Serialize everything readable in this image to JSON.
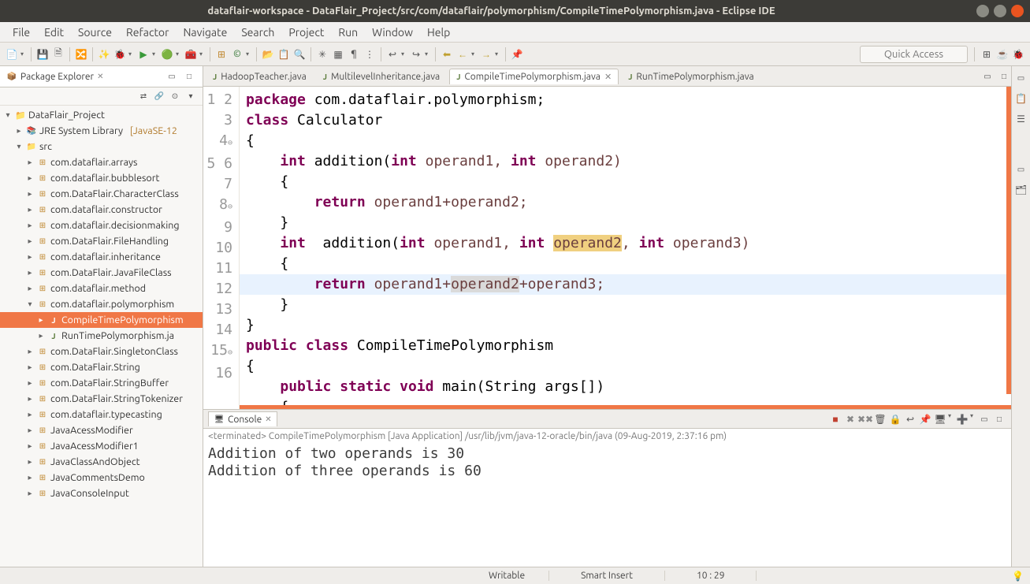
{
  "window": {
    "title": "dataflair-workspace - DataFlair_Project/src/com/dataflair/polymorphism/CompileTimePolymorphism.java - Eclipse IDE"
  },
  "menubar": [
    "File",
    "Edit",
    "Source",
    "Refactor",
    "Navigate",
    "Search",
    "Project",
    "Run",
    "Window",
    "Help"
  ],
  "quick_access": "Quick Access",
  "package_explorer": {
    "title": "Package Explorer",
    "project": "DataFlair_Project",
    "jre": "JRE System Library",
    "jre_ver": "[JavaSE-12",
    "src": "src",
    "packages": [
      "com.dataflair.arrays",
      "com.dataflair.bubblesort",
      "com.DataFlair.CharacterClass",
      "com.dataflair.constructor",
      "com.dataflair.decisionmaking",
      "com.DataFlair.FileHandling",
      "com.dataflair.inheritance",
      "com.DataFlair.JavaFileClass",
      "com.dataflair.method"
    ],
    "open_package": "com.dataflair.polymorphism",
    "open_files": [
      "CompileTimePolymorphism",
      "RunTimePolymorphism.ja"
    ],
    "packages_after": [
      "com.DataFlair.SingletonClass",
      "com.DataFlair.String",
      "com.DataFlair.StringBuffer",
      "com.DataFlair.StringTokenizer",
      "com.dataflair.typecasting",
      "JavaAcessModifier",
      "JavaAcessModifier1",
      "JavaClassAndObject",
      "JavaCommentsDemo",
      "JavaConsoleInput"
    ]
  },
  "editor_tabs": [
    {
      "label": "HadoopTeacher.java",
      "active": false
    },
    {
      "label": "MultilevelInheritance.java",
      "active": false
    },
    {
      "label": "CompileTimePolymorphism.java",
      "active": true
    },
    {
      "label": "RunTimePolymorphism.java",
      "active": false
    }
  ],
  "code": {
    "l1": {
      "a": "package",
      "b": " com.dataflair.polymorphism;"
    },
    "l2": {
      "a": "class",
      "b": " Calculator"
    },
    "l3": "{",
    "l4": {
      "a": "int",
      "b": " addition(",
      "c": "int",
      "d": " operand1, ",
      "e": "int",
      "f": " operand2)"
    },
    "l5": "    {",
    "l6": {
      "a": "return",
      "b": " operand1+operand2;"
    },
    "l7": "    }",
    "l8": {
      "a": "int",
      "b": "  addition(",
      "c": "int",
      "d": " operand1, ",
      "e": "int",
      "f": " ",
      "g": "operand2",
      "h": ", ",
      "i": "int",
      "j": " operand3)"
    },
    "l9": "    {",
    "l10": {
      "a": "return",
      "b": " operand1+",
      "c": "operand2",
      "d": "+operand3;"
    },
    "l11": "    }",
    "l12": "}",
    "l13": {
      "a": "public",
      "b": "class",
      "c": " CompileTimePolymorphism"
    },
    "l14": "{",
    "l15": {
      "a": "public",
      "b": "static",
      "c": "void",
      "d": " main(String args[])"
    },
    "l16": "    {"
  },
  "line_numbers": [
    "1",
    "2",
    "3",
    "4",
    "5",
    "6",
    "7",
    "8",
    "9",
    "10",
    "11",
    "12",
    "13",
    "14",
    "15",
    "16"
  ],
  "console": {
    "title": "Console",
    "header": "<terminated> CompileTimePolymorphism [Java Application] /usr/lib/jvm/java-12-oracle/bin/java (09-Aug-2019, 2:37:16 pm)",
    "out1": "Addition of two operands is 30",
    "out2": "Addition of three operands is 60"
  },
  "status": {
    "writable": "Writable",
    "insert": "Smart Insert",
    "pos": "10 : 29"
  }
}
